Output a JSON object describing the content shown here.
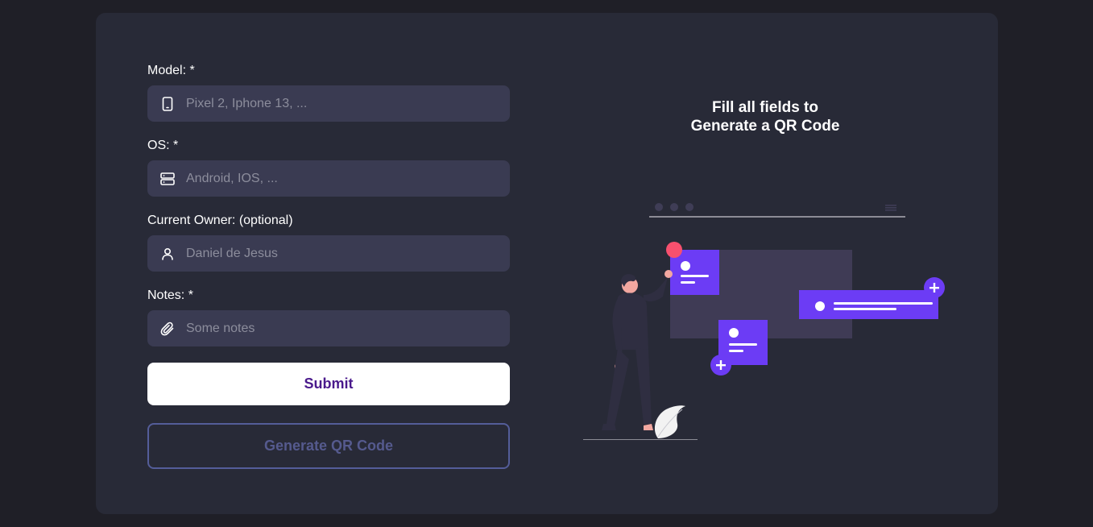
{
  "form": {
    "fields": [
      {
        "label": "Model: *",
        "placeholder": "Pixel 2, Iphone 13, ...",
        "value": "",
        "icon": "phone-icon"
      },
      {
        "label": "OS: *",
        "placeholder": "Android, IOS, ...",
        "value": "",
        "icon": "server-icon"
      },
      {
        "label": "Current Owner: (optional)",
        "placeholder": "Daniel de Jesus",
        "value": "",
        "icon": "user-icon"
      },
      {
        "label": "Notes: *",
        "placeholder": "Some notes",
        "value": "",
        "icon": "paperclip-icon"
      }
    ],
    "submit_label": "Submit",
    "generate_label": "Generate QR Code"
  },
  "qr_panel": {
    "title_line1": "Fill all fields to",
    "title_line2": "Generate a QR Code"
  },
  "colors": {
    "background": "#1f1f27",
    "card": "#282a37",
    "input_bg": "#3a3b52",
    "accent": "#6c3cf5",
    "submit_text": "#4a1a8c",
    "outline": "#545d99",
    "pink": "#f7506e"
  }
}
